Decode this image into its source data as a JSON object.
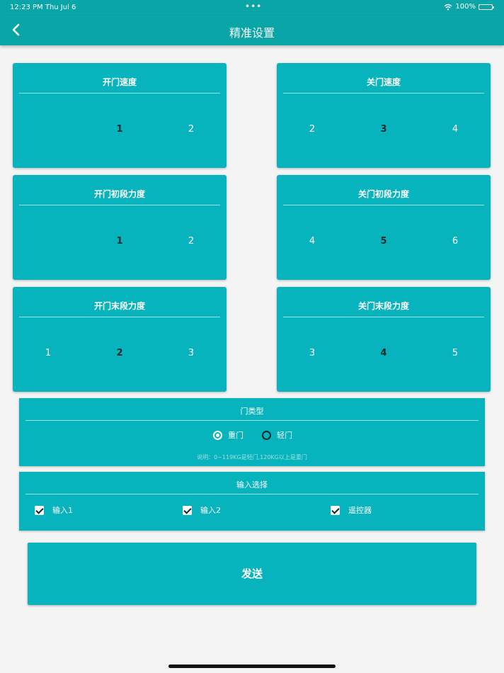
{
  "status_bar": {
    "time": "12:23 PM   Thu Jul 6",
    "dots": "•••",
    "battery": "100%"
  },
  "nav": {
    "title": "精准设置"
  },
  "cards": [
    {
      "title": "开门速度",
      "values": [
        "",
        "1",
        "2"
      ],
      "selected": 1
    },
    {
      "title": "关门速度",
      "values": [
        "2",
        "3",
        "4"
      ],
      "selected": 1
    },
    {
      "title": "开门初段力度",
      "values": [
        "",
        "1",
        "2"
      ],
      "selected": 1
    },
    {
      "title": "关门初段力度",
      "values": [
        "4",
        "5",
        "6"
      ],
      "selected": 1
    },
    {
      "title": "开门末段力度",
      "values": [
        "1",
        "2",
        "3"
      ],
      "selected": 1
    },
    {
      "title": "关门末段力度",
      "values": [
        "3",
        "4",
        "5"
      ],
      "selected": 1
    }
  ],
  "door_type": {
    "title": "门类型",
    "options": [
      {
        "label": "重门",
        "checked": true
      },
      {
        "label": "轻门",
        "checked": false
      }
    ],
    "note": "说明：0~119KG是轻门,120KG以上是重门"
  },
  "input_select": {
    "title": "输入选择",
    "items": [
      {
        "label": "输入1",
        "checked": true
      },
      {
        "label": "输入2",
        "checked": true
      },
      {
        "label": "遥控器",
        "checked": true
      }
    ]
  },
  "send": {
    "label": "发送"
  }
}
